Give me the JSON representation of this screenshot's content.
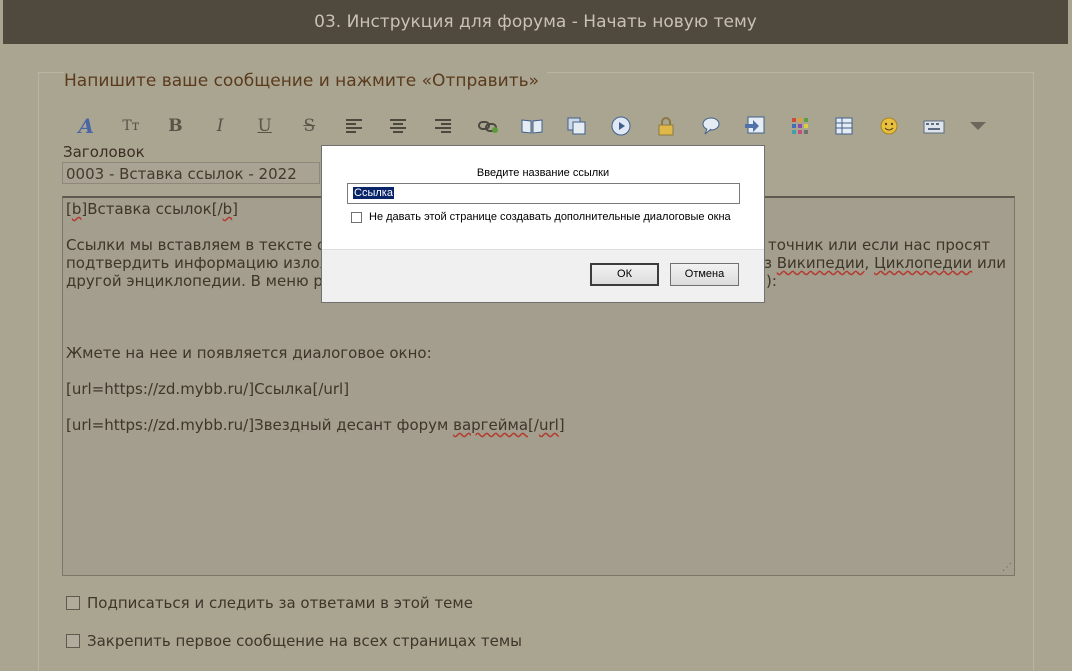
{
  "header": {
    "title": "03. Инструкция для форума - Начать новую тему"
  },
  "form": {
    "title": "Напишите ваше сообщение и нажмите «Отправить»",
    "subject_label": "Заголовок",
    "subject_value": "0003 - Вставка ссылок - 2022"
  },
  "toolbar": {
    "icons": [
      "font-icon",
      "font-size-icon",
      "bold-icon",
      "italic-icon",
      "underline-icon",
      "strikethrough-icon",
      "align-left-icon",
      "align-center-icon",
      "align-right-icon",
      "link-icon",
      "quote-book-icon",
      "copy-icon",
      "media-icon",
      "lock-icon",
      "speech-icon",
      "image-icon",
      "color-icon",
      "table-icon",
      "smile-icon",
      "keyboard-icon",
      "more-icon"
    ]
  },
  "editor": {
    "line1_a": "[",
    "line1_b": "b",
    "line1_c": "]Вставка ссылок[/",
    "line1_d": "b",
    "line1_e": "]",
    "p1_a": "Ссылки мы вставляем в тексте оч",
    "p1_b": "точник или если нас просят",
    "p2_a": "подтвердить информацию излож",
    "p2_b": "з ",
    "p2_wiki": "Википедии",
    "p2_c": ", ",
    "p2_cyclo": "Циклопедии",
    "p2_d": " или",
    "p3_a": "другой энциклопедии. В меню ре",
    "p3_b": "):",
    "p4": "Жмете на нее и появляется диалоговое окно:",
    "p5": "[url=https://zd.mybb.ru/]Ссылка[/url]",
    "p6_a": "[url=https://zd.mybb.ru/]Звездный десант форум ",
    "p6_b": "варгейма",
    "p6_c": "[/",
    "p6_d": "url",
    "p6_e": "]"
  },
  "options": {
    "subscribe": "Подписаться и следить за ответами в этой теме",
    "stick": "Закрепить первое сообщение на всех страницах темы"
  },
  "dialog": {
    "prompt": "Введите название ссылки",
    "input_value": "Ссылка",
    "suppress_label": "Не давать этой странице создавать дополнительные диалоговые окна",
    "ok_label": "ОК",
    "cancel_label": "Отмена"
  }
}
